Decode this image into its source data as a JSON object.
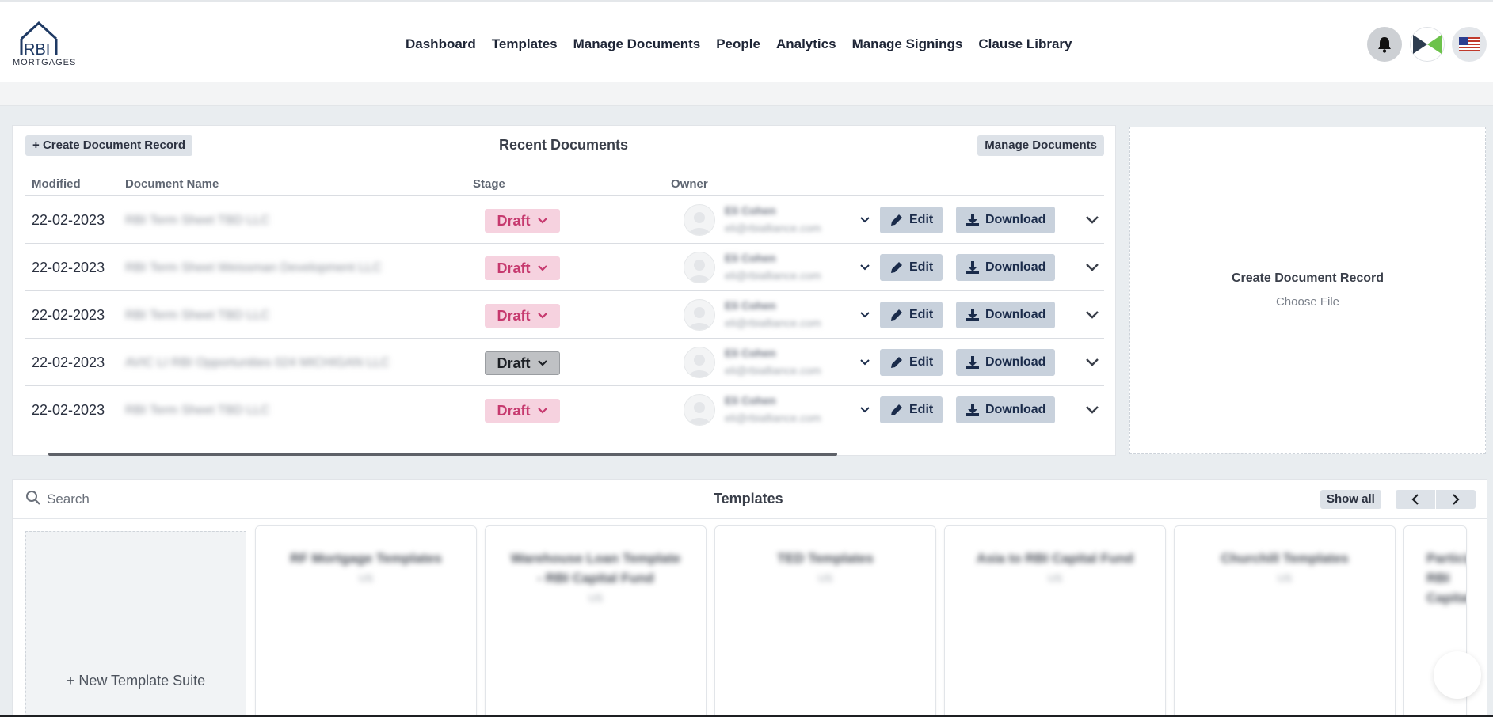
{
  "brand": {
    "logo_text": "RBI",
    "logo_subtext": "MORTGAGES"
  },
  "nav": {
    "items": [
      {
        "label": "Dashboard",
        "active": true
      },
      {
        "label": "Templates"
      },
      {
        "label": "Manage Documents"
      },
      {
        "label": "People"
      },
      {
        "label": "Analytics"
      },
      {
        "label": "Manage Signings"
      },
      {
        "label": "Clause Library"
      }
    ],
    "icons": [
      "bell-icon",
      "brand-icon",
      "us-flag-icon"
    ]
  },
  "recent": {
    "title": "Recent Documents",
    "create_label": "Create Document Record",
    "manage_label": "Manage Documents",
    "columns": {
      "modified": "Modified",
      "name": "Document Name",
      "stage": "Stage",
      "owner": "Owner"
    },
    "rows": [
      {
        "modified": "22-02-2023",
        "name": "RBI Term Sheet TBD LLC",
        "stage": "Draft",
        "stage_style": "pink",
        "owner_name": "Eli Cohen",
        "owner_email": "eli@rbialliance.com"
      },
      {
        "modified": "22-02-2023",
        "name": "RBI Term Sheet Weissman Development LLC",
        "stage": "Draft",
        "stage_style": "pink",
        "owner_name": "Eli Cohen",
        "owner_email": "eli@rbialliance.com"
      },
      {
        "modified": "22-02-2023",
        "name": "RBI Term Sheet TBD LLC",
        "stage": "Draft",
        "stage_style": "pink",
        "owner_name": "Eli Cohen",
        "owner_email": "eli@rbialliance.com"
      },
      {
        "modified": "22-02-2023",
        "name": "AVIC LI RBI Opportunities 024 MICHIGAN LLC",
        "stage": "Draft",
        "stage_style": "grey",
        "owner_name": "Eli Cohen",
        "owner_email": "eli@rbialliance.com"
      },
      {
        "modified": "22-02-2023",
        "name": "RBI Term Sheet TBD LLC",
        "stage": "Draft",
        "stage_style": "pink",
        "owner_name": "Eli Cohen",
        "owner_email": "eli@rbialliance.com"
      }
    ],
    "edit_label": "Edit",
    "download_label": "Download"
  },
  "upload": {
    "title": "Create Document Record",
    "subtitle": "Choose File"
  },
  "templates": {
    "title": "Templates",
    "search_placeholder": "Search",
    "show_all_label": "Show all",
    "new_suite_label": "New Template Suite",
    "cards": [
      {
        "title": "RF Mortgage Templates",
        "sub": "US"
      },
      {
        "title": "Warehouse Loan Template - RBI Capital Fund",
        "sub": "US"
      },
      {
        "title": "TED Templates",
        "sub": "US"
      },
      {
        "title": "Asia to RBI Capital Fund",
        "sub": "US"
      },
      {
        "title": "Churchill Templates",
        "sub": "US"
      },
      {
        "title": "Participation RBI Capital",
        "sub": ""
      }
    ]
  },
  "colors": {
    "accent": "#1f3a64",
    "draft_pink_bg": "#f6d2df",
    "draft_pink_text": "#c6396e",
    "action_bg": "#c8d1dc"
  }
}
